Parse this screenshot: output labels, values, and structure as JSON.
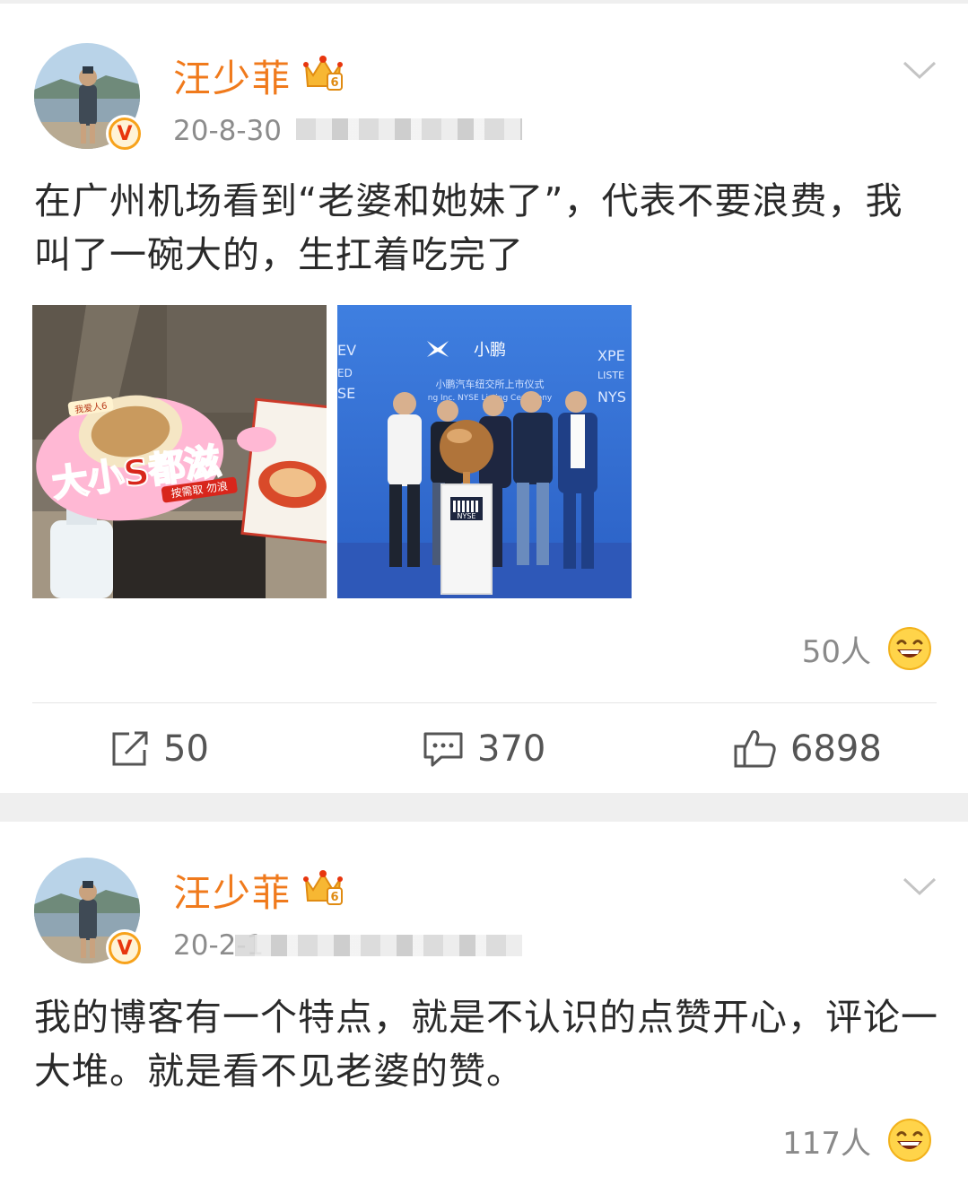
{
  "posts": [
    {
      "username": "汪少菲",
      "timestamp": "20-8-30",
      "text": "在广州机场看到“老婆和她妹了”，代表不要浪费，我叫了一碗大的，生扛着吃完了",
      "reaction_count": "50人",
      "actions": {
        "share": "50",
        "comment": "370",
        "like": "6898"
      },
      "photo1": {
        "sign_text": "大小S都滋",
        "sign_sub": "按需取 勿浪",
        "sticker": "我爱人6"
      },
      "photo2": {
        "logo_text": "小鹏",
        "banner_line": "小鹏汽车纽交所上市仪式",
        "banner_sub": "ng Inc. NYSE Listing Ceremony",
        "left_edge": [
          "EV",
          "ED",
          "SE"
        ],
        "right_edge": [
          "XPE",
          "LISTE",
          "NYS"
        ],
        "podium_text": "NYSE"
      }
    },
    {
      "username": "汪少菲",
      "timestamp": "20-2-1",
      "text": "我的博客有一个特点，就是不认识的点赞开心，评论一大堆。就是看不见老婆的赞。",
      "reaction_count": "117人"
    }
  ],
  "badge_letter": "V",
  "crown_level": "6",
  "colors": {
    "username": "#f07a1c",
    "gray_text": "#8c8c8c",
    "badge": "#f7a21b",
    "separator": "#efefef"
  },
  "icons": [
    "avatar",
    "verified-badge-icon",
    "vip-crown-icon",
    "chevron-down-icon",
    "laughing-emoji-icon",
    "share-icon",
    "comment-icon",
    "thumbs-up-icon"
  ]
}
